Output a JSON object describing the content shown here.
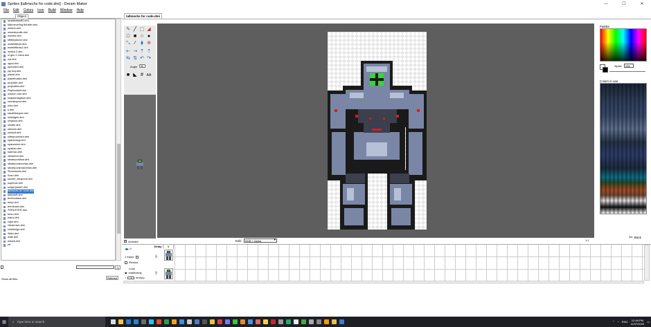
{
  "window": {
    "title": "Sprites [tallmechs for code.dmi] - Dream Maker",
    "buttons": [
      "—",
      "☐",
      "✕"
    ]
  },
  "menu": [
    "File",
    "Edit",
    "Colors",
    "Icon",
    "Build",
    "Window",
    "Help"
  ],
  "left_tab": "Object",
  "files": [
    "lavalandstuff2.dmi",
    "Manoeuvring thruster.dmi",
    "meteor.dmi",
    "minesbundle.dmi",
    "monitor.dmi",
    "Mfibleyboxer.dmi",
    "mobileffects.dmi",
    "mobileffects2.dmi",
    "neekxl.2.dmi",
    "nl gen 2 mech.dmi",
    "nut.dmi",
    "ogod.dmi",
    "operation.dmi",
    "pip boy.dmi",
    "planet.dmi",
    "planetmaker.dmi",
    "propeller.dmi",
    "projectiles.dmi",
    "Psyfonddull.dmi",
    "reactor core.dmi",
    "realplumagboer.dmi",
    "robostoyour.dmi",
    "rotor.dmi",
    "s.dmi",
    "sandhibsuper.dmi",
    "shieldgen.dmi",
    "shiptoud.dmi",
    "shuttle.dmi",
    "skelons.dmi",
    "slorsuit.dmi",
    "sltreprocessor.dmi",
    "spacecorgi.dmi",
    "spacemine.dmi",
    "spartan.dmi",
    "starman.dmi",
    "steambot.dmi",
    "steampuntbod.dmi",
    "steampunkcomps.dmi",
    "steampunkmachines.dmi",
    "Stunshocks.dmi",
    "Suxo.dmi",
    "sunset_weapons.dmi",
    "supercar.dmi",
    "surgerysaw2.dmi",
    "tallmechs for code.dmi",
    "tankstuff.dmi",
    "technoatica.dmi",
    "temp.dmi",
    "terminator.dmi",
    "THRUSTER.dmi",
    "torso.dmi",
    "trains.dmi",
    "cape.dmi",
    "Vantcrown.dmi",
    "vinetrinige.dmi",
    "Wafu.dmi",
    "wafe.dmi",
    "wizard.dmi",
    "ztt"
  ],
  "selected_file": "tallmechs for code.dmi",
  "left_bottom": {
    "show_all": "Show all files",
    "refresh": "Refresh",
    "search_btn": "Q"
  },
  "doc_tab": "tallmechs for code.dmi",
  "tools": {
    "angle_label": "Angle",
    "angle_value": "90",
    "aa": "AA"
  },
  "animate": {
    "label": "Animate",
    "checked": "✓"
  },
  "edit": {
    "label": "Edit:",
    "mode": "RGB + Alpha"
  },
  "zoom": "1:1",
  "palette": {
    "label": "Palette",
    "alpha_label": "Alpha:",
    "alpha_value": "255",
    "colors_in_use": "Colors in use"
  },
  "back": "Back",
  "timeline": {
    "delay": "Delay",
    "frame_no": "1",
    "frames_label": "1 frame",
    "rewind": "Rewind",
    "loop": "Loop",
    "indefinitely": "Indefinitely",
    "times": "time(s)",
    "times_value": "1"
  },
  "taskbar": {
    "search": "Type here to search",
    "time": "12:48 PM",
    "date": "11/07/2020",
    "lang": "ENG"
  },
  "colors": {
    "selection": "#3178d6",
    "canvas_bg": "#5e5e5e",
    "taskbar": "#1d1f24"
  }
}
